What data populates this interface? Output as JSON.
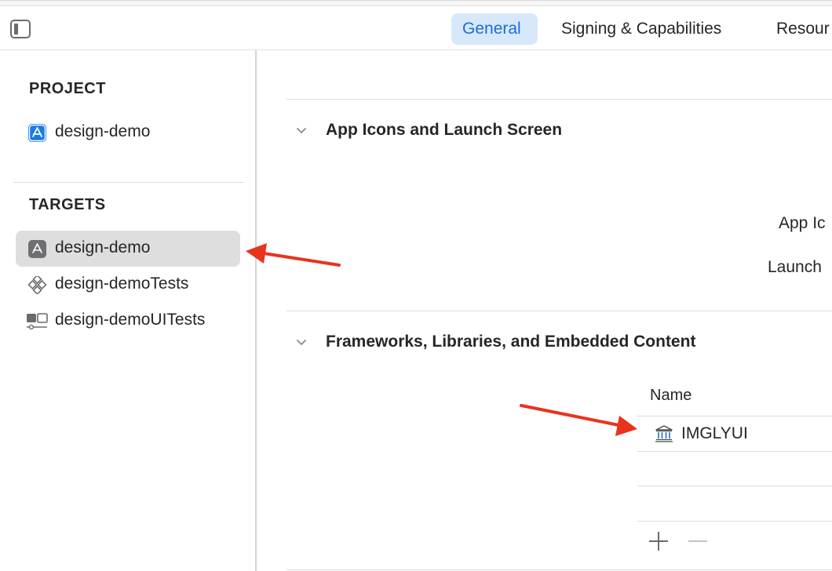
{
  "toolbar": {
    "tabs": [
      {
        "label": "General",
        "active": true
      },
      {
        "label": "Signing & Capabilities",
        "active": false
      },
      {
        "label": "Resour",
        "active": false
      }
    ]
  },
  "sidebar": {
    "project_header": "PROJECT",
    "project_items": [
      {
        "label": "design-demo",
        "icon": "app-store-icon"
      }
    ],
    "targets_header": "TARGETS",
    "target_items": [
      {
        "label": "design-demo",
        "icon": "app-target-icon",
        "selected": true
      },
      {
        "label": "design-demoTests",
        "icon": "unit-test-icon",
        "selected": false
      },
      {
        "label": "design-demoUITests",
        "icon": "ui-test-icon",
        "selected": false
      }
    ]
  },
  "main": {
    "sections": [
      {
        "title": "App Icons and Launch Screen",
        "fields": [
          "App Ic",
          "Launch"
        ]
      },
      {
        "title": "Frameworks, Libraries, and Embedded Content"
      }
    ],
    "frameworks": {
      "column_name": "Name",
      "rows": [
        {
          "name": "IMGLYUI",
          "icon": "library-icon"
        }
      ],
      "add_symbol": "+",
      "remove_symbol": "−"
    }
  },
  "colors": {
    "accent": "#1a6ed8",
    "active_tab_bg": "#d7e8fb",
    "selection_bg": "#dedede",
    "annotation_arrow": "#e8341c"
  }
}
